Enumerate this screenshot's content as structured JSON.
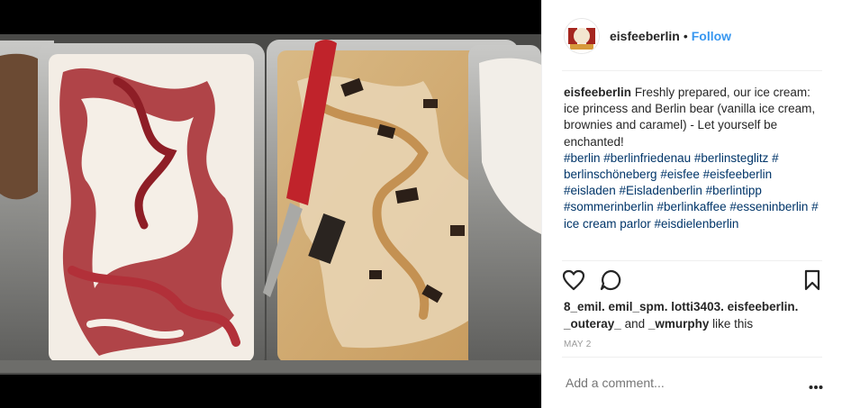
{
  "post": {
    "username": "eisfeeberlin",
    "dot": "•",
    "follow_label": "Follow",
    "caption_user": "eisfeeberlin",
    "caption_text": "Freshly prepared, our ice cream: ice princess and Berlin bear (vanilla ice cream, brownies and caramel) - Let yourself be enchanted!",
    "hashtags": "#berlin #berlinfriedenau #berlinsteglitz # berlinschöneberg #eisfee #eisfeeberlin #eisladen #Eisladenberlin #berlintipp #sommerinberlin #berlinkaffee #esseninberlin # ice cream parlor #eisdielenberlin",
    "likes_users": "8_emil. emil_spm. lotti3403. eisfeeberlin. _outeray_",
    "likes_and": "and",
    "likes_last": "_wmurphy",
    "likes_suffix": "like this",
    "date": "MAY 2",
    "comment_placeholder": "Add a comment..."
  },
  "icons": {
    "like": "heart-icon",
    "comment": "comment-bubble-icon",
    "save": "bookmark-icon",
    "more": "more-options-icon"
  },
  "colors": {
    "follow": "#3897f0",
    "hashtag": "#003569",
    "muted": "#999999"
  }
}
